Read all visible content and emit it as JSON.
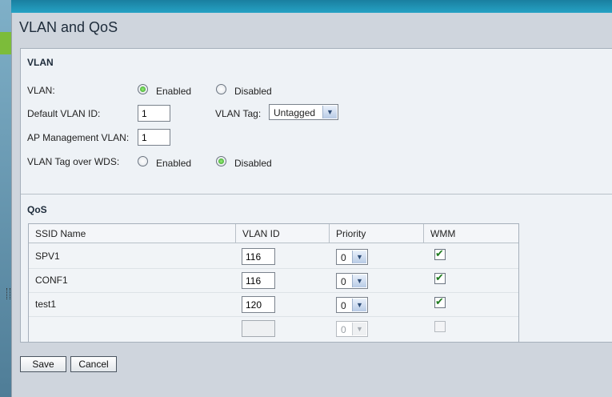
{
  "page": {
    "title": "VLAN and QoS"
  },
  "vlan": {
    "section_title": "VLAN",
    "vlan_label": "VLAN:",
    "vlan_enabled_label": "Enabled",
    "vlan_disabled_label": "Disabled",
    "vlan_selected": "Enabled",
    "default_vlan_id_label": "Default VLAN ID:",
    "default_vlan_id": "1",
    "vlan_tag_label": "VLAN Tag:",
    "vlan_tag_value": "Untagged",
    "ap_mgmt_vlan_label": "AP Management VLAN:",
    "ap_mgmt_vlan": "1",
    "tag_over_wds_label": "VLAN Tag over WDS:",
    "tag_over_wds_enabled_label": "Enabled",
    "tag_over_wds_disabled_label": "Disabled",
    "tag_over_wds_selected": "Disabled"
  },
  "qos": {
    "section_title": "QoS",
    "columns": [
      "SSID Name",
      "VLAN ID",
      "Priority",
      "WMM"
    ],
    "rows": [
      {
        "ssid": "SPV1",
        "vlan_id": "116",
        "priority": "0",
        "wmm": true
      },
      {
        "ssid": "CONF1",
        "vlan_id": "116",
        "priority": "0",
        "wmm": true
      },
      {
        "ssid": "test1",
        "vlan_id": "120",
        "priority": "0",
        "wmm": true
      },
      {
        "ssid": "",
        "vlan_id": "",
        "priority": "0",
        "wmm": false,
        "disabled": true
      }
    ]
  },
  "buttons": {
    "save": "Save",
    "cancel": "Cancel"
  },
  "icons": {
    "select_arrow": "chevron-down-icon",
    "checked": "check-icon"
  },
  "colors": {
    "accent_blue": "#25a2c4",
    "radio_on": "#2a9a1e"
  }
}
